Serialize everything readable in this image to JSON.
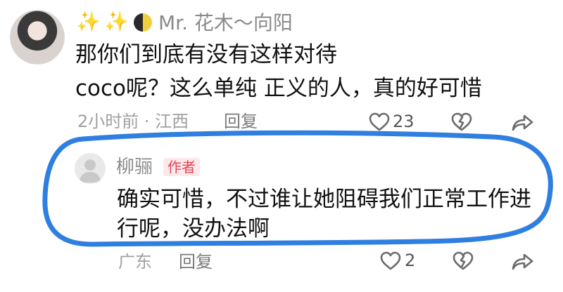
{
  "comment": {
    "username": "Mr. 花木～向阳",
    "text_line1": "那你们到底有没有这样对待",
    "text_line2": "coco呢？这么单纯 正义的人，真的好可惜",
    "meta": "2小时前 · 江西",
    "reply_label": "回复",
    "like_count": "23"
  },
  "reply": {
    "username": "柳骊",
    "badge": "作者",
    "text_line1": "确实可惜，不过谁让她阻碍我们正常工作进",
    "text_line2": "行呢，没办法啊",
    "location": "广东",
    "reply_label": "回复",
    "like_count": "2"
  },
  "colors": {
    "highlight_outline": "#2f7fe0",
    "badge_text": "#e64356",
    "badge_bg": "#fde8ea"
  },
  "icons": [
    "sparkle-icon",
    "moon-icon",
    "heart-icon",
    "dislike-heart-icon",
    "share-icon",
    "default-avatar-icon"
  ]
}
